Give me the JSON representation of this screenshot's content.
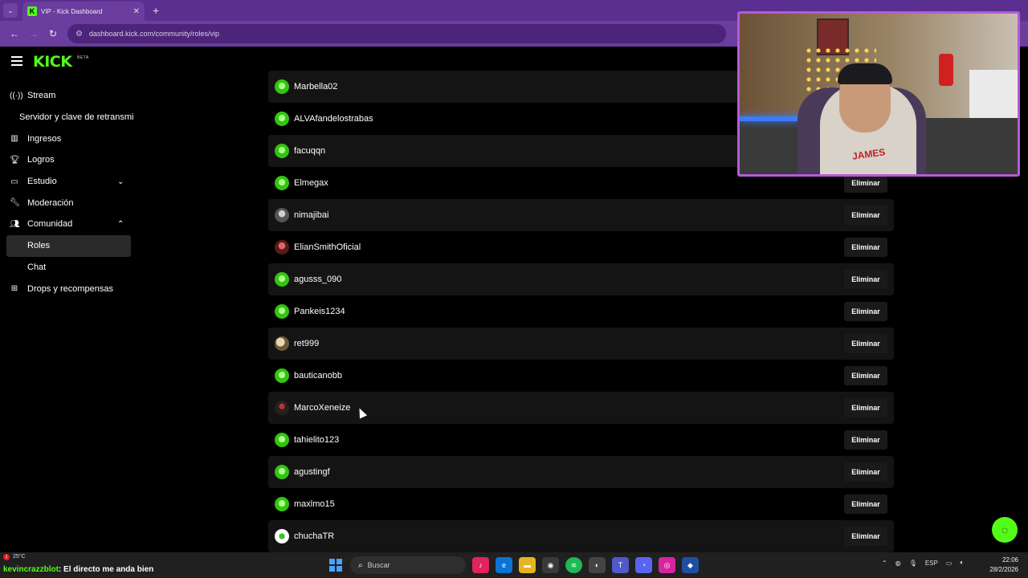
{
  "browser": {
    "tab_title": "VIP - Kick Dashboard",
    "tab_favicon": "K",
    "url": "dashboard.kick.com/community/roles/vip"
  },
  "app": {
    "logo": "KICK",
    "logo_badge": "BETA",
    "brand_color": "#53fc18"
  },
  "sidebar": {
    "items": [
      {
        "label": "Stream",
        "icon": "broadcast-icon"
      },
      {
        "label": "Servidor y clave de retransmi"
      },
      {
        "label": "Ingresos",
        "icon": "chart-icon"
      },
      {
        "label": "Logros",
        "icon": "trophy-icon"
      },
      {
        "label": "Estudio",
        "icon": "monitor-icon",
        "expand": "chevron-down"
      },
      {
        "label": "Moderación",
        "icon": "wrench-icon"
      },
      {
        "label": "Comunidad",
        "icon": "users-icon",
        "expand": "chevron-up"
      },
      {
        "label": "Roles",
        "active": true
      },
      {
        "label": "Chat"
      },
      {
        "label": "Drops y recompensas",
        "icon": "gift-icon"
      }
    ]
  },
  "vip_list": {
    "remove_label": "Eliminar",
    "users": [
      "Marbella02",
      "ALVAfandelostrabas",
      "facuqqn",
      "Elmegax",
      "nimajibai",
      "ElianSmithOficial",
      "agusss_090",
      "Pankeis1234",
      "ret999",
      "bauticanobb",
      "MarcoXeneize",
      "tahielito123",
      "agustingf",
      "maxlmo15",
      "chuchaTR"
    ]
  },
  "webcam": {
    "shirt_text": "JAMES"
  },
  "taskbar": {
    "weather": "25°C",
    "weather_badge": "1",
    "chat_user": "kevincrazzblot",
    "chat_message": ": El directo me anda bien",
    "search_placeholder": "Buscar",
    "language": "ESP",
    "time": "22:06",
    "date": "28/2/2026"
  }
}
